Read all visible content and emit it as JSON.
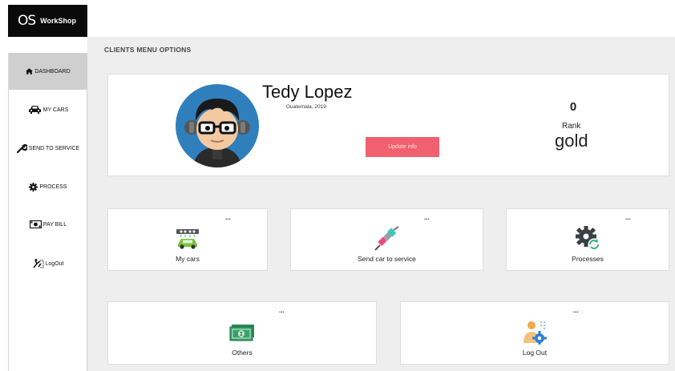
{
  "app": {
    "logo_mark": "OS",
    "logo_name": "WorkShop"
  },
  "sidebar": {
    "items": [
      {
        "label": "DASHBOARD",
        "icon": "home-icon",
        "active": true
      },
      {
        "label": "MY CARS",
        "icon": "car-icon"
      },
      {
        "label": "SEND TO SERVICE",
        "icon": "wrench-icon"
      },
      {
        "label": "PROCESS",
        "icon": "gear-icon"
      },
      {
        "label": "PAY BILL",
        "icon": "money-icon"
      },
      {
        "label": "LogOut",
        "icon": "logout-icon"
      }
    ]
  },
  "main": {
    "section_title": "CLIENTS MENU OPTIONS",
    "profile": {
      "name": "Tedy Lopez",
      "location": "Guatemala, 2019",
      "update_label": "Update info",
      "points": "0",
      "rank_label": "Rank",
      "rank_value": "gold"
    },
    "tiles": [
      {
        "label": "My cars",
        "dots": "...",
        "icon": "car-wash-icon"
      },
      {
        "label": "Send car to service",
        "dots": "...",
        "icon": "spark-plug-icon"
      },
      {
        "label": "Processes",
        "dots": "...",
        "icon": "gear-refresh-icon"
      },
      {
        "label": "Others",
        "dots": "...",
        "icon": "cash-icon"
      },
      {
        "label": "Log Out",
        "dots": "...",
        "icon": "user-settings-icon"
      }
    ]
  },
  "colors": {
    "accent": "#f0606e",
    "avatar_bg": "#2f7fbd",
    "sidebar_active": "#cfcfcf",
    "background": "#eeeeee"
  }
}
